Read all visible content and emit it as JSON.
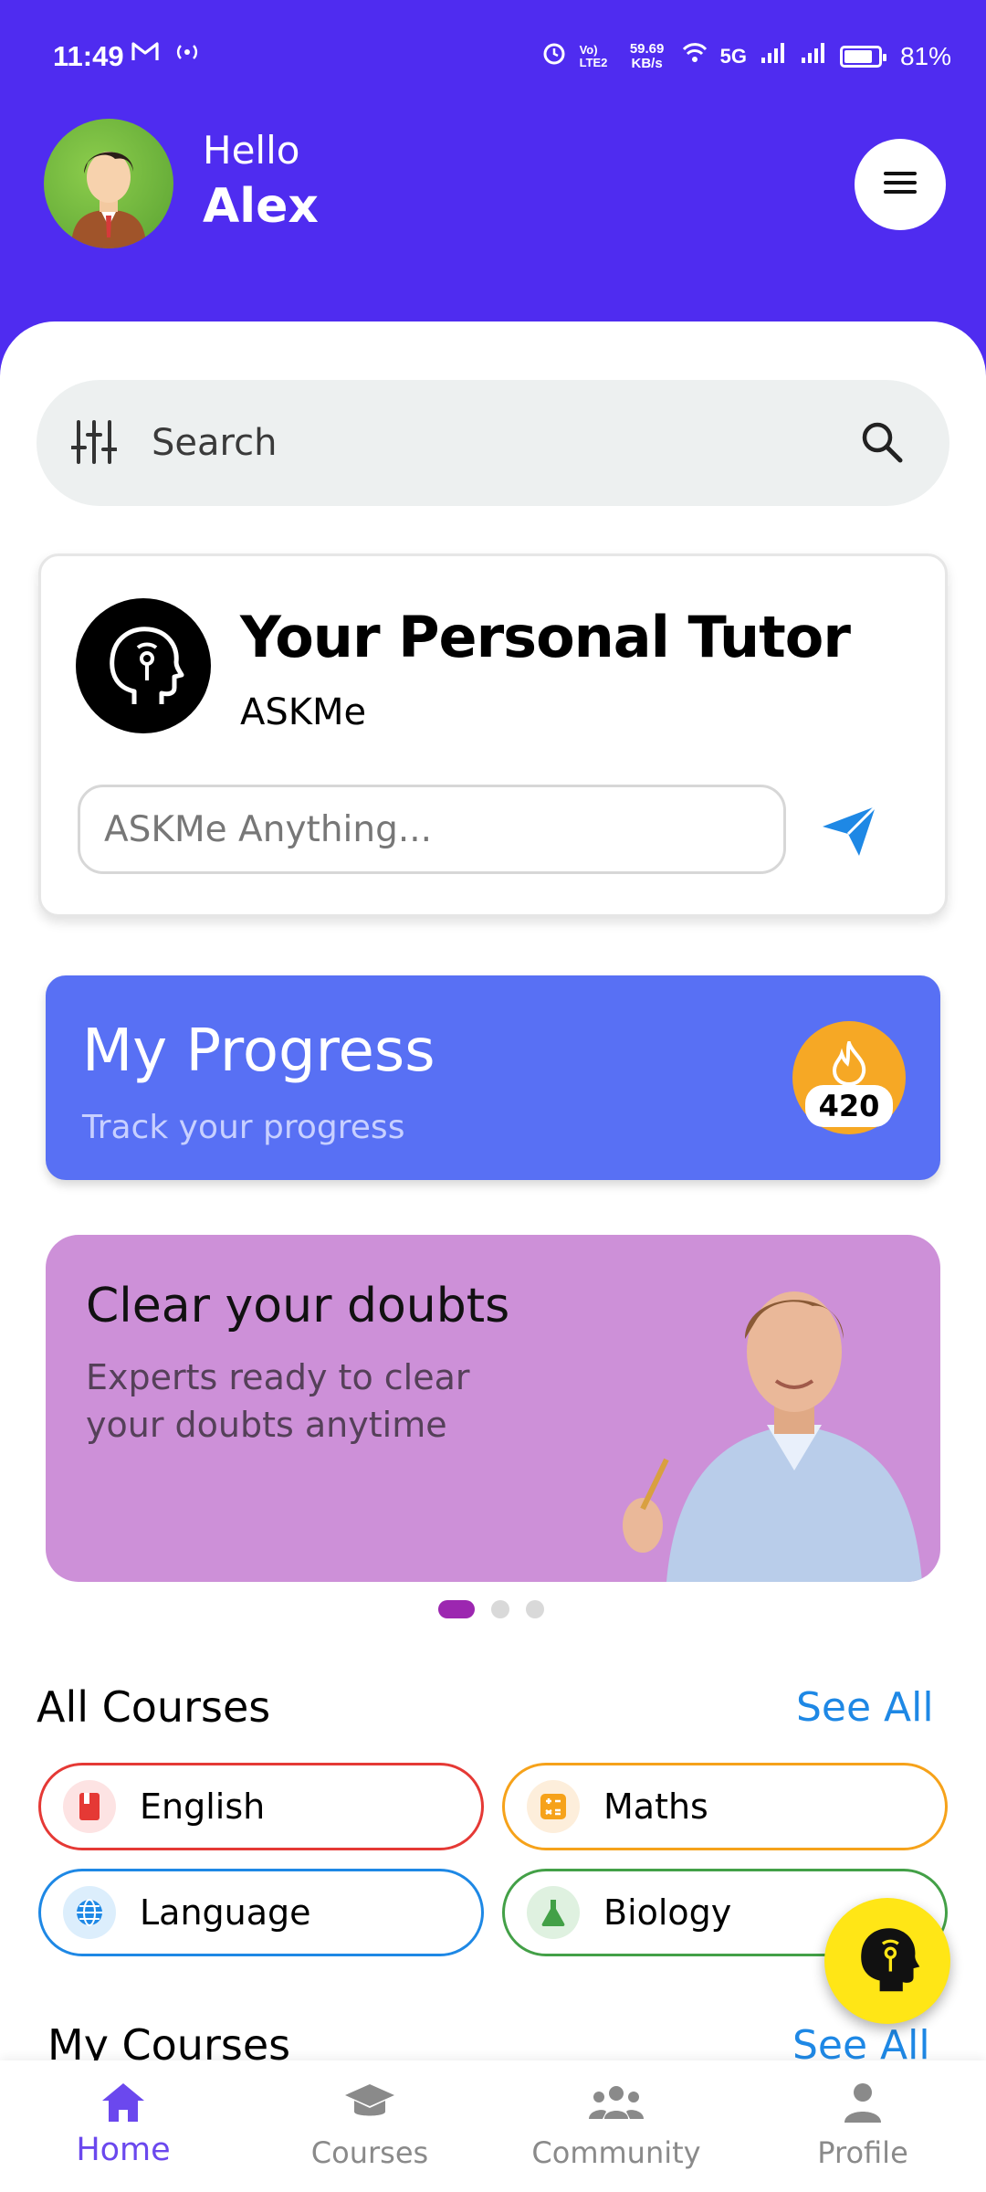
{
  "status_bar": {
    "time": "11:49",
    "volte": "Vo) LTE2",
    "speed": "59.69 KB/s",
    "network": "5G",
    "battery": "81%"
  },
  "header": {
    "greeting": "Hello",
    "user_name": "Alex"
  },
  "search": {
    "placeholder": "Search"
  },
  "tutor_card": {
    "title": "Your Personal Tutor",
    "subtitle": "ASKMe",
    "input_placeholder": "ASKMe Anything..."
  },
  "progress_card": {
    "title": "My Progress",
    "subtitle": "Track your progress",
    "streak_count": "420"
  },
  "banner": {
    "title": "Clear your doubts",
    "subtitle": "Experts ready to clear your doubts anytime",
    "slides_total": 3,
    "active_slide": 1
  },
  "all_courses": {
    "title": "All Courses",
    "see_all": "See All",
    "items": [
      {
        "label": "English",
        "color": "#e53935",
        "icon": "book-icon"
      },
      {
        "label": "Maths",
        "color": "#f6a21a",
        "icon": "calculator-icon"
      },
      {
        "label": "Language",
        "color": "#1e88e5",
        "icon": "globe-icon"
      },
      {
        "label": "Biology",
        "color": "#43a047",
        "icon": "flask-icon"
      }
    ]
  },
  "my_courses": {
    "title": "My Courses",
    "see_all": "See All"
  },
  "bottom_nav": {
    "items": [
      {
        "label": "Home",
        "icon": "home-icon",
        "active": true
      },
      {
        "label": "Courses",
        "icon": "graduation-cap-icon",
        "active": false
      },
      {
        "label": "Community",
        "icon": "community-icon",
        "active": false
      },
      {
        "label": "Profile",
        "icon": "profile-icon",
        "active": false
      }
    ]
  },
  "colors": {
    "header": "#4f2cf0",
    "progress": "#5870f4",
    "banner": "#cd90d8",
    "accent_blue": "#1e88e5",
    "nav_active": "#6b48ee",
    "fab": "#ffe616"
  }
}
